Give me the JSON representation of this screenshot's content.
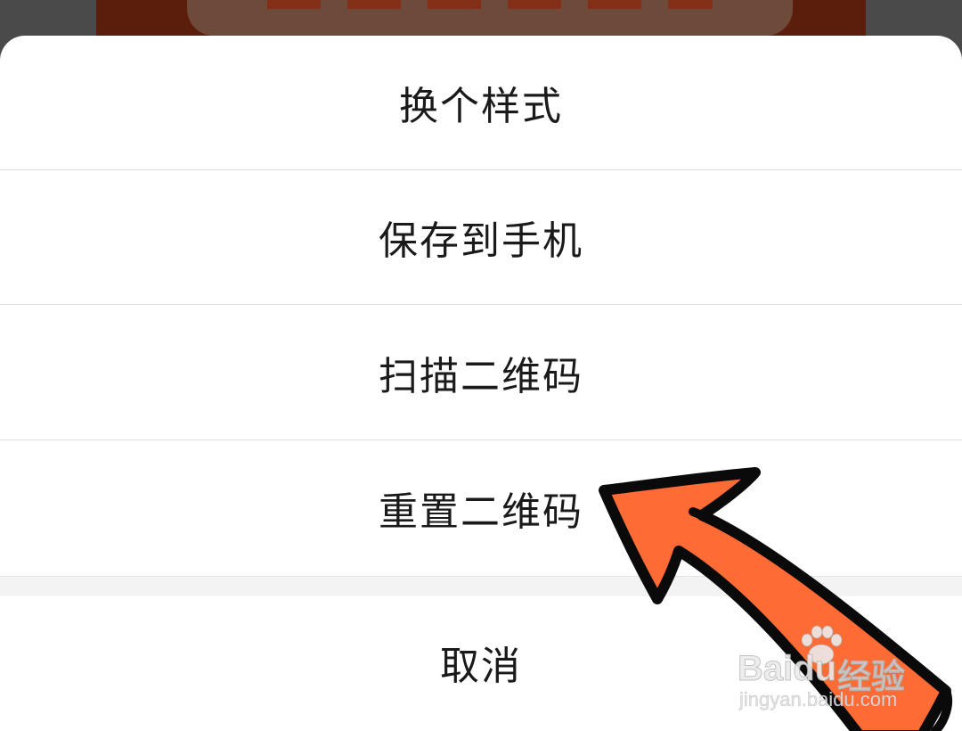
{
  "action_sheet": {
    "options": [
      {
        "label": "换个样式"
      },
      {
        "label": "保存到手机"
      },
      {
        "label": "扫描二维码"
      },
      {
        "label": "重置二维码"
      }
    ],
    "cancel_label": "取消"
  },
  "annotation": {
    "arrow_color": "#FF6B35",
    "points_to": "重置二维码"
  },
  "watermark": {
    "brand": "Baidu",
    "brand_cn": "经验",
    "url": "jingyan.baidu.com"
  }
}
